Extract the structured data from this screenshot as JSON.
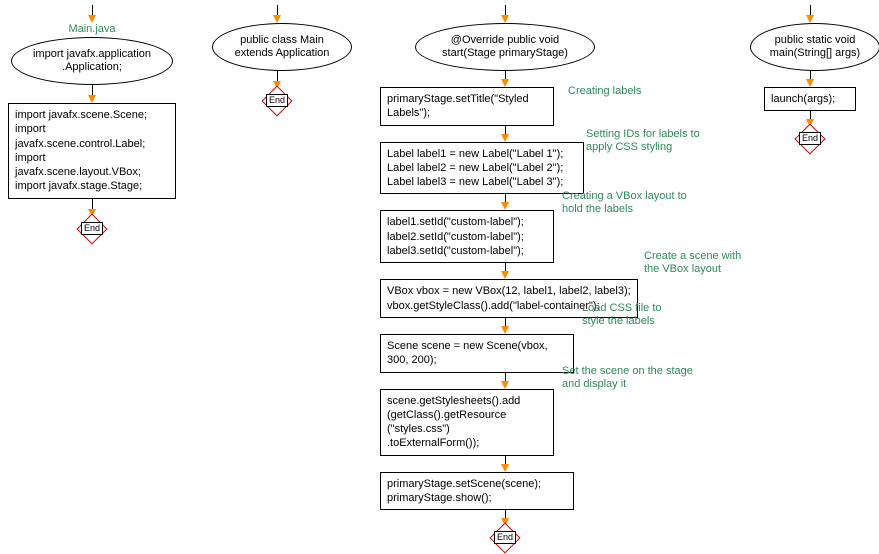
{
  "col1": {
    "title": "Main.java",
    "ellipse": "import javafx.application\n.Application;",
    "box": "import javafx.scene.Scene;\nimport javafx.scene.control.Label;\nimport javafx.scene.layout.VBox;\nimport javafx.stage.Stage;",
    "end": "End"
  },
  "col2": {
    "ellipse": "public class Main\nextends Application",
    "end": "End"
  },
  "col3": {
    "ellipse": "@Override public void\nstart(Stage primaryStage)",
    "box1": "primaryStage.setTitle(\"Styled\nLabels\");",
    "box2": "Label label1 = new Label(\"Label 1\");\nLabel label2 = new Label(\"Label 2\");\nLabel label3 = new Label(\"Label 3\");",
    "box3": "label1.setId(\"custom-label\");\nlabel2.setId(\"custom-label\");\nlabel3.setId(\"custom-label\");",
    "box4": "VBox vbox = new VBox(12, label1, label2, label3);\nvbox.getStyleClass().add(\"label-container\");",
    "box5": "Scene scene = new Scene(vbox,\n300, 200);",
    "box6": "scene.getStylesheets().add\n(getClass().getResource\n(\"styles.css\")\n.toExternalForm());",
    "box7": "primaryStage.setScene(scene);\nprimaryStage.show();",
    "end": "End",
    "annot1": "Creating labels",
    "annot2": "Setting IDs for labels to\napply CSS styling",
    "annot3": "Creating a VBox layout to\nhold the labels",
    "annot4": "Create a scene with\nthe VBox layout",
    "annot5": "Load CSS file to\nstyle the labels",
    "annot6": "Set the scene on the stage\nand display it"
  },
  "col4": {
    "ellipse": "public static void\nmain(String[] args)",
    "box": "launch(args);",
    "end": "End"
  }
}
